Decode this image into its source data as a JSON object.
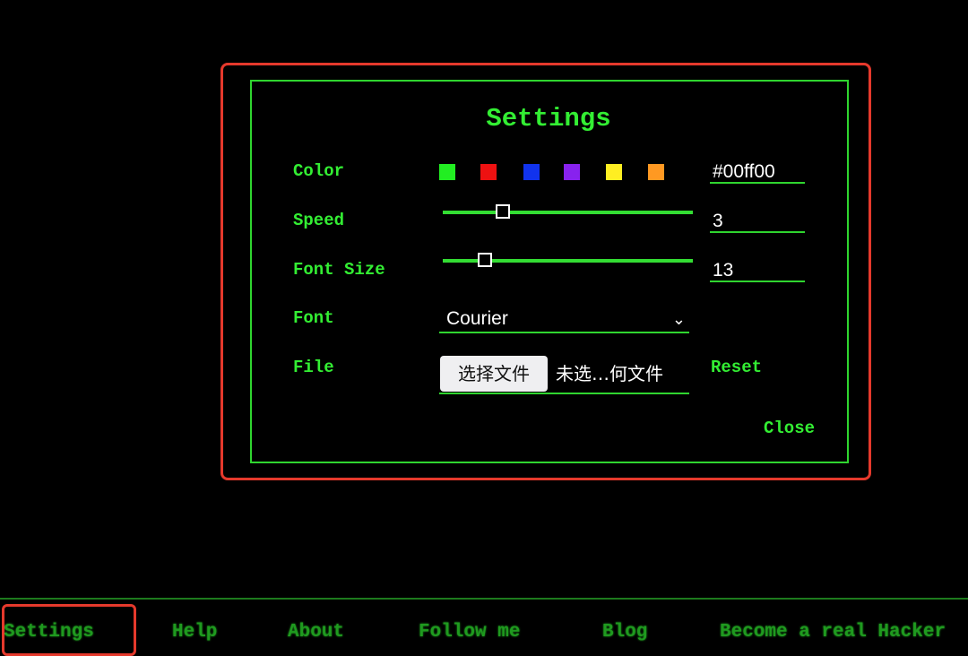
{
  "dialog": {
    "title": "Settings",
    "labels": {
      "color": "Color",
      "speed": "Speed",
      "font_size": "Font Size",
      "font": "Font",
      "file": "File"
    },
    "color_swatches": [
      "#22ee22",
      "#ee1111",
      "#1133ee",
      "#8822ee",
      "#ffee22",
      "#ff9922"
    ],
    "color_value": "#00ff00",
    "speed_value": "3",
    "speed_slider_percent": 24,
    "font_size_value": "13",
    "font_size_slider_percent": 17,
    "font_selected": "Courier",
    "file_button": "选择文件",
    "file_status": "未选…何文件",
    "reset": "Reset",
    "close": "Close"
  },
  "nav": {
    "items": [
      "Settings",
      "Help",
      "About",
      "Follow me",
      "Blog",
      "Become a real Hacker"
    ]
  },
  "colors": {
    "accent": "#33ee33",
    "highlight": "#e5392c",
    "background": "#000000"
  }
}
